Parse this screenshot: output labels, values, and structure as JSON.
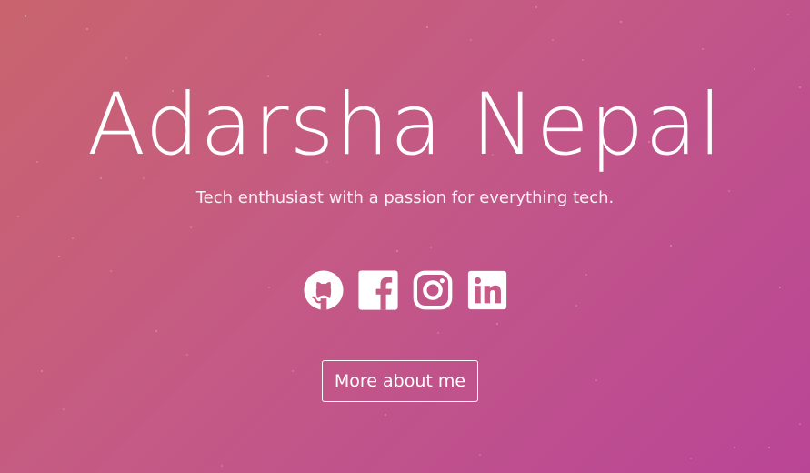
{
  "hero": {
    "name": "Adarsha Nepal",
    "tagline": "Tech enthusiast with a passion for everything tech."
  },
  "socials": [
    {
      "icon": "github-icon"
    },
    {
      "icon": "facebook-icon"
    },
    {
      "icon": "instagram-icon"
    },
    {
      "icon": "linkedin-icon"
    }
  ],
  "cta": {
    "label": "More about me"
  },
  "colors": {
    "gradient_start": "#c9646e",
    "gradient_mid": "#c45a85",
    "gradient_end": "#b94596",
    "text": "#ffffff"
  }
}
